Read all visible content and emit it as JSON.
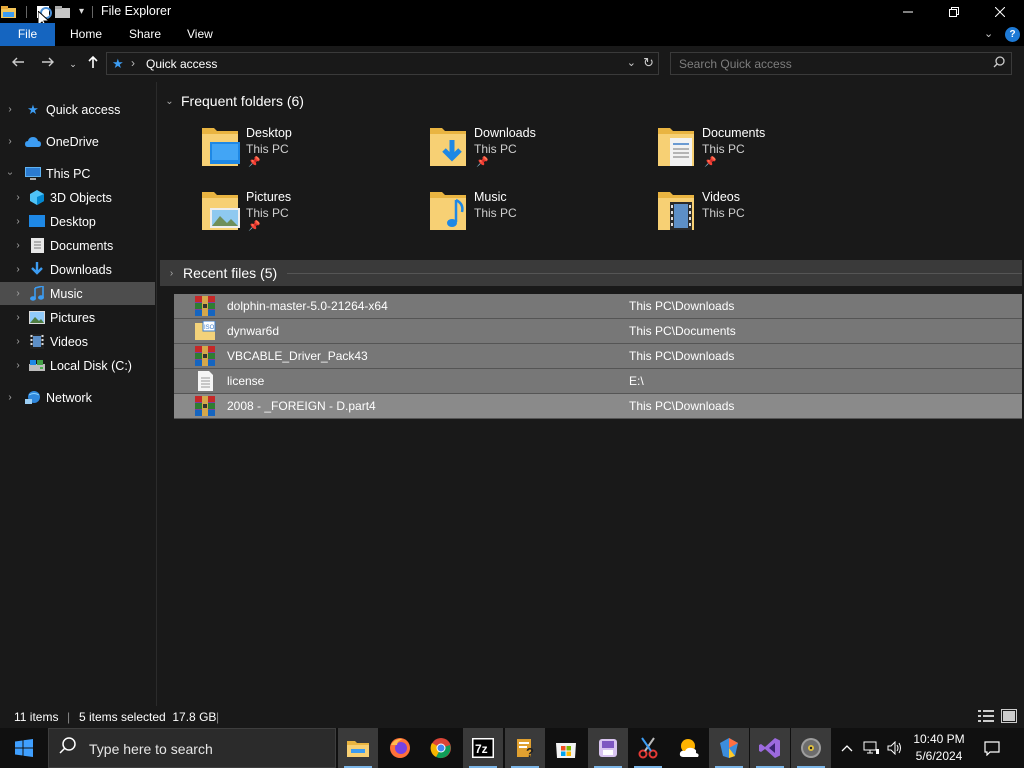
{
  "window": {
    "title": "File Explorer"
  },
  "ribbon": {
    "tabs": [
      "File",
      "Home",
      "Share",
      "View"
    ]
  },
  "address": {
    "path": "Quick access",
    "search_placeholder": "Search Quick access"
  },
  "sidebar": {
    "items": [
      {
        "label": "Quick access",
        "icon": "star-icon"
      },
      {
        "label": "OneDrive",
        "icon": "cloud-icon"
      },
      {
        "label": "This PC",
        "icon": "computer-icon"
      },
      {
        "label": "3D Objects",
        "icon": "cube-icon"
      },
      {
        "label": "Desktop",
        "icon": "desktop-icon"
      },
      {
        "label": "Documents",
        "icon": "document-icon"
      },
      {
        "label": "Downloads",
        "icon": "download-icon"
      },
      {
        "label": "Music",
        "icon": "music-icon"
      },
      {
        "label": "Pictures",
        "icon": "picture-icon"
      },
      {
        "label": "Videos",
        "icon": "video-icon"
      },
      {
        "label": "Local Disk (C:)",
        "icon": "drive-icon"
      },
      {
        "label": "Network",
        "icon": "network-icon"
      }
    ],
    "selected": "Music"
  },
  "frequent": {
    "heading": "Frequent folders (6)",
    "folders": [
      {
        "name": "Desktop",
        "location": "This PC",
        "pinned": true
      },
      {
        "name": "Downloads",
        "location": "This PC",
        "pinned": true
      },
      {
        "name": "Documents",
        "location": "This PC",
        "pinned": true
      },
      {
        "name": "Pictures",
        "location": "This PC",
        "pinned": true
      },
      {
        "name": "Music",
        "location": "This PC",
        "pinned": false
      },
      {
        "name": "Videos",
        "location": "This PC",
        "pinned": false
      }
    ]
  },
  "recent": {
    "heading": "Recent files (5)",
    "files": [
      {
        "name": "dolphin-master-5.0-21264-x64",
        "location": "This PC\\Downloads",
        "icon": "winrar-archive-icon"
      },
      {
        "name": "dynwar6d",
        "location": "This PC\\Documents",
        "icon": "iso-image-icon"
      },
      {
        "name": "VBCABLE_Driver_Pack43",
        "location": "This PC\\Downloads",
        "icon": "winrar-archive-icon"
      },
      {
        "name": "license",
        "location": "E:\\",
        "icon": "text-file-icon"
      },
      {
        "name": "2008 - _FOREIGN - D.part4",
        "location": "This PC\\Downloads",
        "icon": "winrar-archive-icon"
      }
    ]
  },
  "status": {
    "items": "11 items",
    "selected": "5 items selected  17.8 GB"
  },
  "taskbar": {
    "search_placeholder": "Type here to search",
    "time": "10:40 PM",
    "date": "5/6/2024"
  },
  "colors": {
    "accent": "#1565c0",
    "folder": "#f3c55a",
    "selection": "#777777"
  }
}
